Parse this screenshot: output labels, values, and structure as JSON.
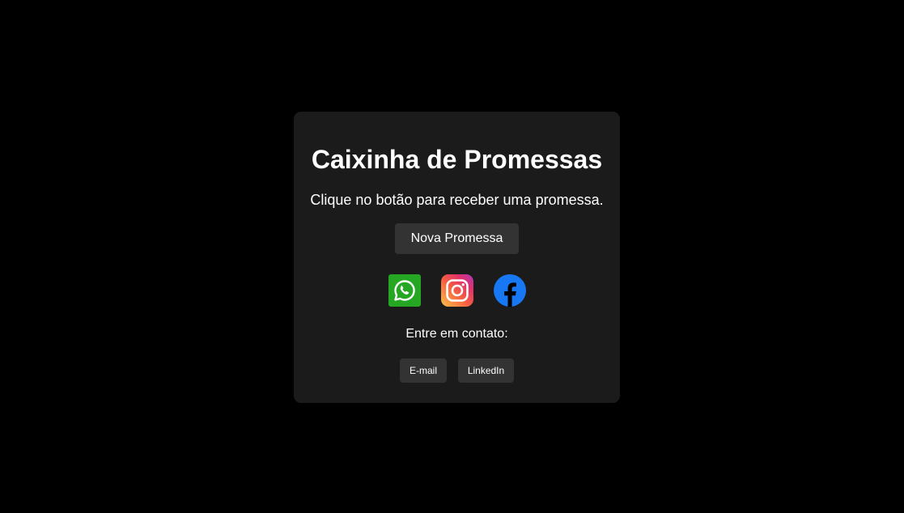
{
  "card": {
    "title": "Caixinha de Promessas",
    "subtitle": "Clique no botão para receber uma promessa.",
    "new_promise_label": "Nova Promessa",
    "socials": [
      {
        "name": "whatsapp-icon",
        "color": "#25a723"
      },
      {
        "name": "instagram-icon",
        "color": "#e1306c"
      },
      {
        "name": "facebook-icon",
        "color": "#1877f2"
      }
    ],
    "contact_label": "Entre em contato:",
    "email_label": "E-mail",
    "linkedin_label": "LinkedIn"
  },
  "colors": {
    "page_background": "#000000",
    "card_background": "#1b1b1b",
    "button_background": "#333333",
    "text": "#ffffff"
  }
}
